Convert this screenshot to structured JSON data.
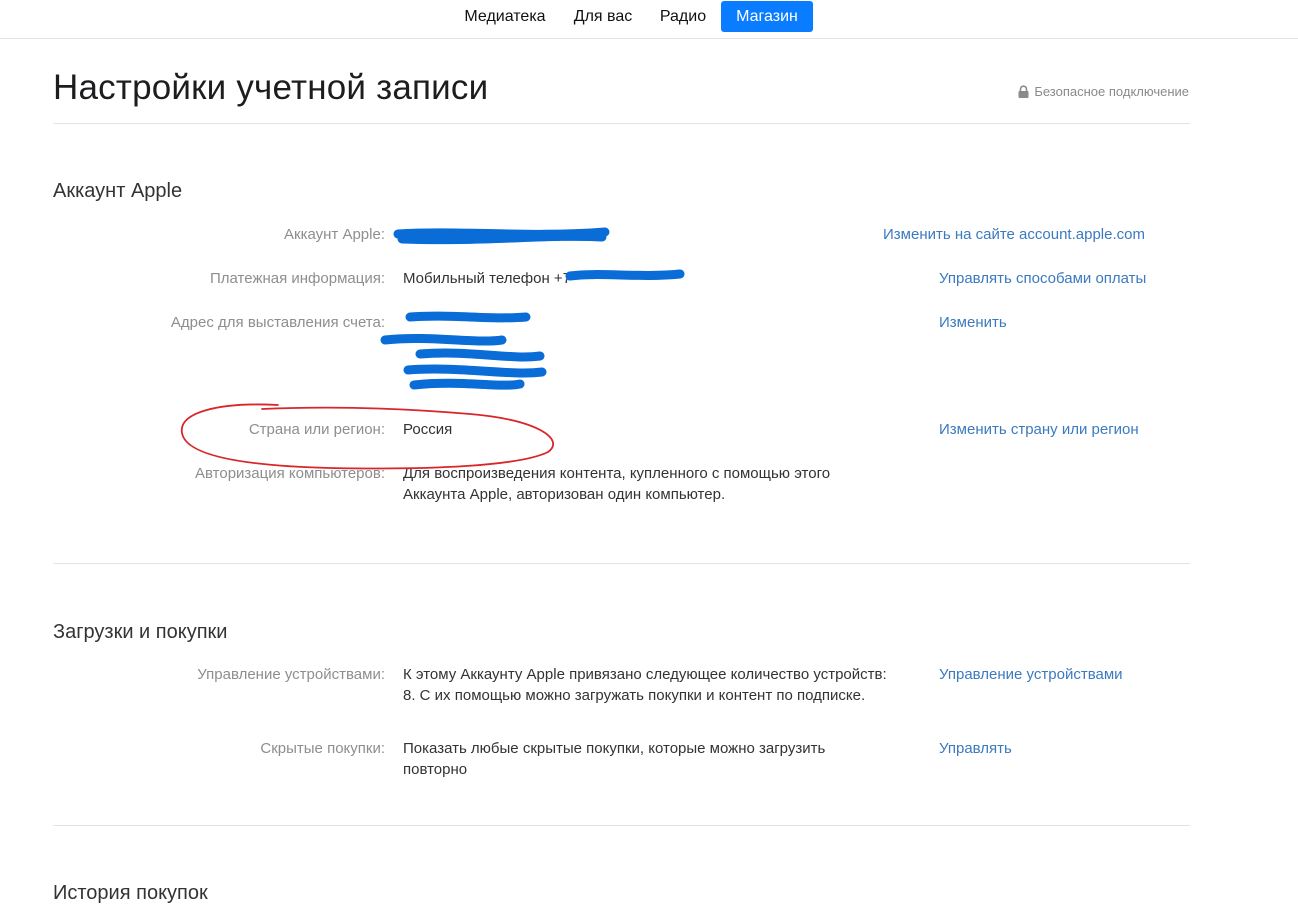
{
  "nav": {
    "tabs": [
      {
        "label": "Медиатека"
      },
      {
        "label": "Для вас"
      },
      {
        "label": "Радио"
      },
      {
        "label": "Магазин"
      }
    ],
    "active_tab": "Магазин"
  },
  "header": {
    "title": "Настройки учетной записи",
    "secure_label": "Безопасное подключение",
    "secure_icon": "lock-icon"
  },
  "apple_account": {
    "heading": "Аккаунт Apple",
    "rows": [
      {
        "label": "Аккаунт Apple:",
        "value": "",
        "action": "Изменить на сайте account.apple.com"
      },
      {
        "label": "Платежная информация:",
        "value": "Мобильный телефон +7",
        "action": "Управлять способами оплаты"
      },
      {
        "label": "Адрес для выставления счета:",
        "value": "",
        "action": "Изменить"
      },
      {
        "label": "Страна или регион:",
        "value": "Россия",
        "action": "Изменить страну или регион"
      },
      {
        "label": "Авторизация компьютеров:",
        "value": "Для воспроизведения контента, купленного с помощью этого Аккаунта Apple, авторизован один компьютер.",
        "action": ""
      }
    ]
  },
  "downloads": {
    "heading": "Загрузки и покупки",
    "rows": [
      {
        "label": "Управление устройствами:",
        "value": "К этому Аккаунту Apple привязано следующее количество устройств: 8. С их помощью можно загружать покупки и контент по подписке.",
        "action": "Управление устройствами"
      },
      {
        "label": "Скрытые покупки:",
        "value": "Показать любые скрытые покупки, которые можно загрузить повторно",
        "action": "Управлять"
      }
    ]
  },
  "history": {
    "heading": "История покупок"
  },
  "colors": {
    "accent": "#0a7cff",
    "link": "#3b7abf",
    "redaction": "#0a6cd6",
    "annotation": "#d8262b"
  }
}
